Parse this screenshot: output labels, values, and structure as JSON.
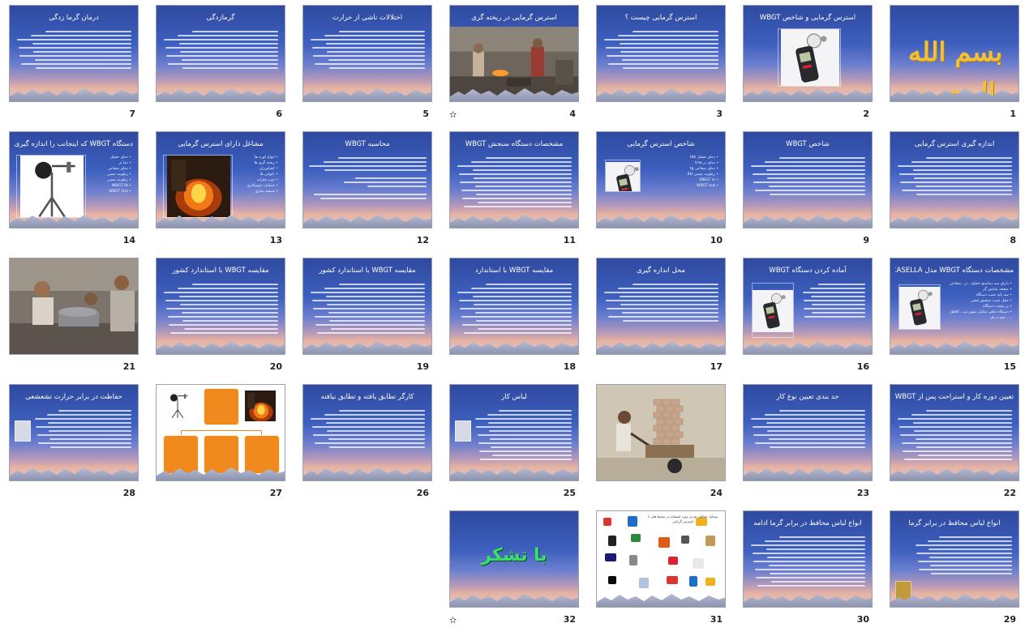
{
  "slides": [
    {
      "n": "1",
      "title": "",
      "type": "calligraphy",
      "calli": "بسم الله الرحمن الرحیم"
    },
    {
      "n": "2",
      "title": "استرس گرمایی و شاخص WBGT",
      "type": "device"
    },
    {
      "n": "3",
      "title": "استرس گرمایی چیست ؟",
      "type": "text"
    },
    {
      "n": "4",
      "title": "استرس گرمایی در ریخته گری",
      "type": "photo-top"
    },
    {
      "n": "5",
      "title": "اختلالات ناشی از حرارت",
      "type": "text"
    },
    {
      "n": "6",
      "title": "گرمازدگی",
      "type": "text"
    },
    {
      "n": "7",
      "title": "درمان گرما زدگی",
      "type": "text"
    },
    {
      "n": "8",
      "title": "اندازه گیری استرس گرمایی",
      "type": "text"
    },
    {
      "n": "9",
      "title": "شاخص WBGT",
      "type": "text"
    },
    {
      "n": "10",
      "title": "شاخص استرس گرمایی",
      "type": "list-pic",
      "items": [
        "دمای خشک tdb",
        "دمای تر tnw",
        "دمای شعاعی tg",
        "رطوبت نسبی RH",
        "WBGT in",
        "WBGT out"
      ]
    },
    {
      "n": "11",
      "title": "مشخصات دستگاه سنجش WBGT",
      "type": "text-dense"
    },
    {
      "n": "12",
      "title": "محاسبه WBGT",
      "type": "formula"
    },
    {
      "n": "13",
      "title": "مشاغل دارای استرس گرمایی",
      "type": "list-pic-left",
      "items": [
        "انواع کوره ها",
        "ریخته گری ها",
        "کشاورزان",
        "نانوایی ها",
        "ذوب فلزات",
        "عملیات جوشکاری",
        "شیشه سازی"
      ]
    },
    {
      "n": "14",
      "title": "دستگاه WBGT که اینجانب را اندازه گیری می کند",
      "type": "list-pic-left",
      "items": [
        "دمای خشک",
        "دما تر",
        "دمای شعاعی",
        "رطوبت نسبی",
        "رطوبت نسبی",
        "WBGT IN",
        "WBGT Out"
      ]
    },
    {
      "n": "15",
      "title": "مشخصات دستگاه WBGT مدل CASELLA",
      "type": "list-pic",
      "items": [
        "دارای سه دماسنج خشک ، تر ، شعاعی",
        "صفحه نمایش گر",
        "سه پایه نصب دستگاه",
        "محل نصب سنسور فشی",
        "بر بیشت دستگاه",
        "دستکاه ماهی شامل سوپر تب ، کلاهک ، ... فتو ه بنک"
      ]
    },
    {
      "n": "16",
      "title": "آماده کردن دستگاه WBGT",
      "type": "list-pic"
    },
    {
      "n": "17",
      "title": "محل اندازه گیری",
      "type": "text"
    },
    {
      "n": "18",
      "title": "مقایسه WBGT با استاندارد",
      "type": "text-dense"
    },
    {
      "n": "19",
      "title": "مقایسه WBGT با استاندارد کشور",
      "type": "text-dense"
    },
    {
      "n": "20",
      "title": "مقایسه WBGT با استاندارد کشور",
      "type": "text-dense"
    },
    {
      "n": "21",
      "title": "",
      "type": "photo-full",
      "variant": "workers"
    },
    {
      "n": "22",
      "title": "تعیین دوره کار و استراحت پس از WBGT",
      "type": "text-dense"
    },
    {
      "n": "23",
      "title": "حد بندی تعیین نوع کار",
      "type": "text"
    },
    {
      "n": "24",
      "title": "",
      "type": "photo-full",
      "variant": "bricks"
    },
    {
      "n": "25",
      "title": "لباس کار",
      "type": "text-dense-pic"
    },
    {
      "n": "26",
      "title": "کارگر تطابق یافته و تطابق نیافته",
      "type": "text"
    },
    {
      "n": "27",
      "title": "",
      "type": "diagram"
    },
    {
      "n": "28",
      "title": "حفاظت در برابر حرارت تشعشعی",
      "type": "text-pic"
    },
    {
      "n": "29",
      "title": "انواع لباس محافظ در برابر گرما",
      "type": "text-pic"
    },
    {
      "n": "30",
      "title": "انواع لباس محافظ در برابر گرما ادامه",
      "type": "text-dense"
    },
    {
      "n": "31",
      "title": "وسایل حفاظت فردی مورد استفاده در محیط های با استرس گرمایی",
      "type": "icons"
    },
    {
      "n": "32",
      "title": "",
      "type": "thanks",
      "thanks": "با تشکر"
    }
  ],
  "star_symbol": "✫",
  "star_slides": [
    "4",
    "32"
  ]
}
